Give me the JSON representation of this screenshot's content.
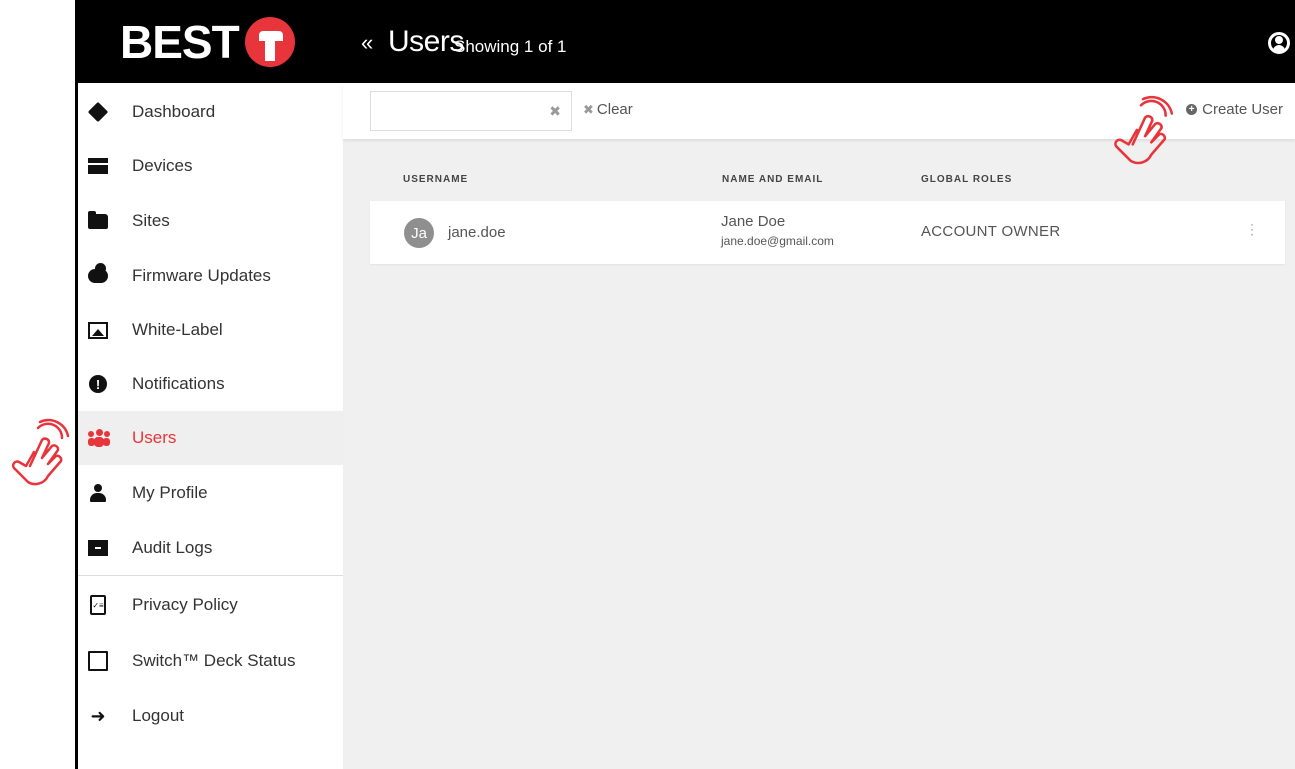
{
  "brand": {
    "name": "BEST"
  },
  "header": {
    "collapse_glyph": "«",
    "title": "Users",
    "subtitle": "Showing 1 of 1"
  },
  "sidebar": {
    "items": [
      {
        "label": "Dashboard",
        "icon": "dashboard-icon"
      },
      {
        "label": "Devices",
        "icon": "devices-icon"
      },
      {
        "label": "Sites",
        "icon": "folder-icon"
      },
      {
        "label": "Firmware Updates",
        "icon": "cloud-upload-icon"
      },
      {
        "label": "White-Label",
        "icon": "image-icon"
      },
      {
        "label": "Notifications",
        "icon": "alert-icon"
      },
      {
        "label": "Users",
        "icon": "users-icon",
        "active": true
      },
      {
        "label": "My Profile",
        "icon": "person-icon"
      },
      {
        "label": "Audit Logs",
        "icon": "archive-icon"
      },
      {
        "label": "Privacy Policy",
        "icon": "clipboard-icon"
      },
      {
        "label": "Switch™ Deck Status",
        "icon": "deck-status-icon"
      },
      {
        "label": "Logout",
        "icon": "logout-icon"
      }
    ]
  },
  "toolbar": {
    "search_value": "",
    "search_clear_glyph": "✖",
    "clear_label": "Clear",
    "clear_glyph": "✖",
    "create_label": "Create User",
    "create_glyph": "+"
  },
  "table": {
    "columns": [
      "USERNAME",
      "NAME AND EMAIL",
      "GLOBAL ROLES"
    ],
    "rows": [
      {
        "initials": "Ja",
        "username": "jane.doe",
        "name": "Jane Doe",
        "email": "jane.doe@gmail.com",
        "role": "ACCOUNT OWNER",
        "menu_glyph": "⋮"
      }
    ]
  },
  "colors": {
    "accent": "#e8343b",
    "topbar": "#000000",
    "main_bg": "#f0f0f0"
  }
}
